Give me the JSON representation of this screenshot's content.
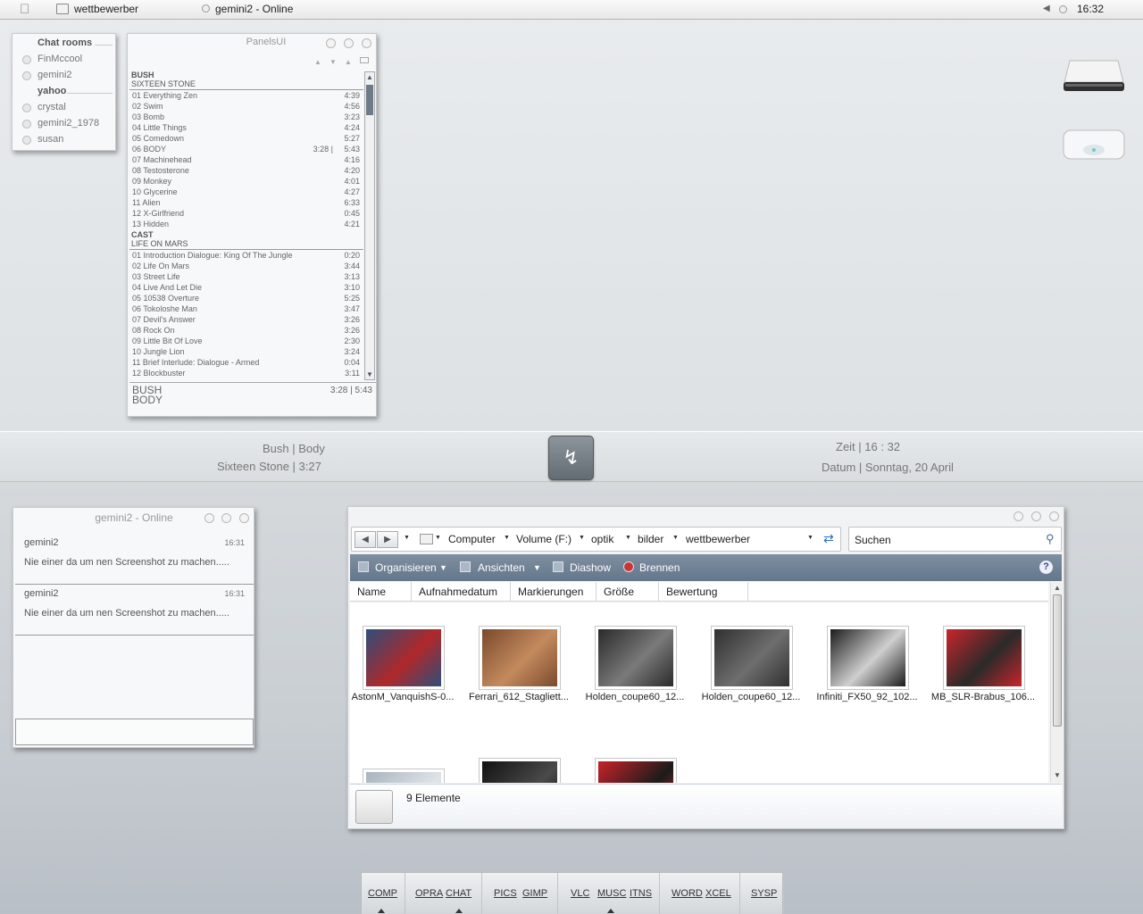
{
  "menubar": {
    "title_left": "wettbewerber",
    "title_center": "gemini2 - Online",
    "clock": "16:32"
  },
  "chatrooms": {
    "items": [
      {
        "label": "Chat rooms",
        "header": true
      },
      {
        "label": "FinMccool"
      },
      {
        "label": "gemini2"
      },
      {
        "label": "yahoo",
        "header": true
      },
      {
        "label": "crystal"
      },
      {
        "label": "gemini2_1978"
      },
      {
        "label": "susan"
      }
    ]
  },
  "panelsui": {
    "title": "PanelsUI",
    "albums": [
      {
        "artist": "BUSH",
        "album": "SIXTEEN STONE",
        "tracks": [
          {
            "n": "01",
            "t": "Everything Zen",
            "l": "4:39"
          },
          {
            "n": "02",
            "t": "Swim",
            "l": "4:56"
          },
          {
            "n": "03",
            "t": "Bomb",
            "l": "3:23"
          },
          {
            "n": "04",
            "t": "Little Things",
            "l": "4:24"
          },
          {
            "n": "05",
            "t": "Comedown",
            "l": "5:27"
          },
          {
            "n": "06",
            "t": "BODY",
            "l": "5:43",
            "p": "3:28  |"
          },
          {
            "n": "07",
            "t": "Machinehead",
            "l": "4:16"
          },
          {
            "n": "08",
            "t": "Testosterone",
            "l": "4:20"
          },
          {
            "n": "09",
            "t": "Monkey",
            "l": "4:01"
          },
          {
            "n": "10",
            "t": "Glycerine",
            "l": "4:27"
          },
          {
            "n": "11",
            "t": "Alien",
            "l": "6:33"
          },
          {
            "n": "12",
            "t": "X-Girlfriend",
            "l": "0:45"
          },
          {
            "n": "13",
            "t": "Hidden",
            "l": "4:21"
          }
        ]
      },
      {
        "artist": "CAST",
        "album": "LIFE ON MARS",
        "tracks": [
          {
            "n": "01",
            "t": "Introduction Dialogue: King Of The Jungle",
            "l": "0:20"
          },
          {
            "n": "02",
            "t": "Life On Mars",
            "l": "3:44"
          },
          {
            "n": "03",
            "t": "Street Life",
            "l": "3:13"
          },
          {
            "n": "04",
            "t": "Live And Let Die",
            "l": "3:10"
          },
          {
            "n": "05",
            "t": "10538 Overture",
            "l": "5:25"
          },
          {
            "n": "06",
            "t": "Tokoloshe Man",
            "l": "3:47"
          },
          {
            "n": "07",
            "t": "Devil's Answer",
            "l": "3:26"
          },
          {
            "n": "08",
            "t": "Rock On",
            "l": "3:26"
          },
          {
            "n": "09",
            "t": "Little Bit Of Love",
            "l": "2:30"
          },
          {
            "n": "10",
            "t": "Jungle Lion",
            "l": "3:24"
          },
          {
            "n": "11",
            "t": "Brief Interlude: Dialogue - Armed",
            "l": "0:04"
          },
          {
            "n": "12",
            "t": "Blockbuster",
            "l": "3:11"
          }
        ]
      }
    ],
    "footer_artist": "BUSH",
    "footer_track": "BODY",
    "footer_time": "3:28 | 5:43"
  },
  "nowplaying": {
    "line1": "Bush |  Body",
    "line2": "Sixteen Stone |  3:27",
    "zeit": "Zeit |   16 : 32",
    "datum": "Datum | Sonntag, 20 April"
  },
  "chat": {
    "title": "gemini2 - Online",
    "messages": [
      {
        "user": "gemini2",
        "time": "16:31",
        "text": "Nie einer da um nen Screenshot zu machen....."
      },
      {
        "user": "gemini2",
        "time": "16:31",
        "text": "Nie einer da um nen Screenshot zu machen....."
      }
    ]
  },
  "explorer": {
    "breadcrumbs": [
      "Computer",
      "Volume (F:)",
      "optik",
      "bilder",
      "wettbewerber"
    ],
    "search_placeholder": "Suchen",
    "toolbar": [
      "Organisieren",
      "Ansichten",
      "Diashow",
      "Brennen"
    ],
    "columns": [
      "Name",
      "Aufnahmedatum",
      "Markierungen",
      "Größe",
      "Bewertung"
    ],
    "files": [
      {
        "name": "AstonM_VanquishS-0...",
        "c1": "#2e4e7a",
        "c2": "#b0282a"
      },
      {
        "name": "Ferrari_612_Stagliett...",
        "c1": "#7a4a2c",
        "c2": "#c48a5e"
      },
      {
        "name": "Holden_coupe60_12...",
        "c1": "#2a2a2a",
        "c2": "#7a7a7a"
      },
      {
        "name": "Holden_coupe60_12...",
        "c1": "#303030",
        "c2": "#6e6e6e"
      },
      {
        "name": "Infiniti_FX50_92_102...",
        "c1": "#1c1c1c",
        "c2": "#cfcfcf"
      },
      {
        "name": "MB_SLR-Brabus_106...",
        "c1": "#c9252b",
        "c2": "#2a2a2a"
      }
    ],
    "partial_files": [
      {
        "c1": "#a7b3be",
        "c2": "#e0e4e8"
      },
      {
        "c1": "#121212",
        "c2": "#4a4a4a"
      },
      {
        "c1": "#c8232a",
        "c2": "#1b1b1b"
      }
    ],
    "count": "9 Elemente"
  },
  "dock": {
    "items": [
      "COMP",
      "OPRA",
      "CHAT",
      "PICS",
      "GIMP",
      "VLC",
      "MUSC",
      "ITNS",
      "WORD",
      "XCEL",
      "SYSP"
    ]
  }
}
